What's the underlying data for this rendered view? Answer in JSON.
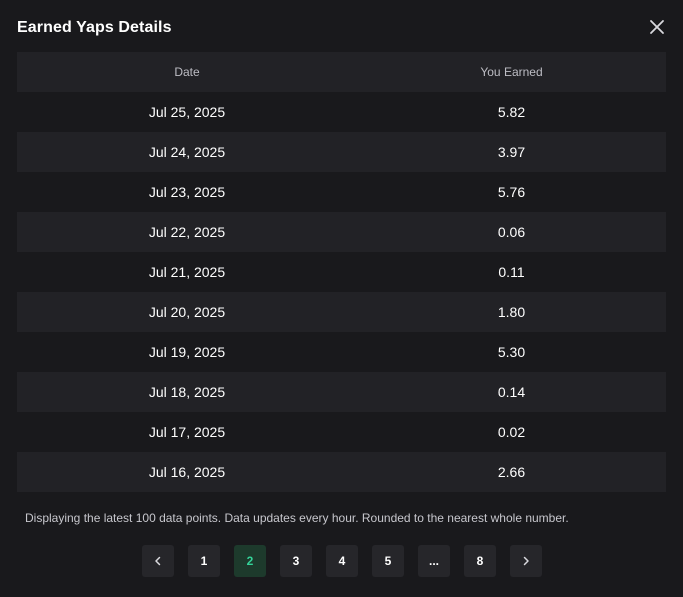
{
  "modal": {
    "title": "Earned Yaps Details",
    "close_icon": "close-icon"
  },
  "table": {
    "headers": {
      "date": "Date",
      "earned": "You Earned"
    },
    "rows": [
      {
        "date": "Jul 25, 2025",
        "earned": "5.82"
      },
      {
        "date": "Jul 24, 2025",
        "earned": "3.97"
      },
      {
        "date": "Jul 23, 2025",
        "earned": "5.76"
      },
      {
        "date": "Jul 22, 2025",
        "earned": "0.06"
      },
      {
        "date": "Jul 21, 2025",
        "earned": "0.11"
      },
      {
        "date": "Jul 20, 2025",
        "earned": "1.80"
      },
      {
        "date": "Jul 19, 2025",
        "earned": "5.30"
      },
      {
        "date": "Jul 18, 2025",
        "earned": "0.14"
      },
      {
        "date": "Jul 17, 2025",
        "earned": "0.02"
      },
      {
        "date": "Jul 16, 2025",
        "earned": "2.66"
      }
    ]
  },
  "footnote": "Displaying the latest 100 data points. Data updates every hour. Rounded to the nearest whole number.",
  "pagination": {
    "prev_icon": "chevron-left-icon",
    "next_icon": "chevron-right-icon",
    "pages": [
      "1",
      "2",
      "3",
      "4",
      "5",
      "...",
      "8"
    ],
    "current": "2"
  },
  "colors": {
    "background": "#19191c",
    "row_alt": "#222226",
    "active_page_bg": "#1d3a2c",
    "active_page_text": "#34d399"
  }
}
